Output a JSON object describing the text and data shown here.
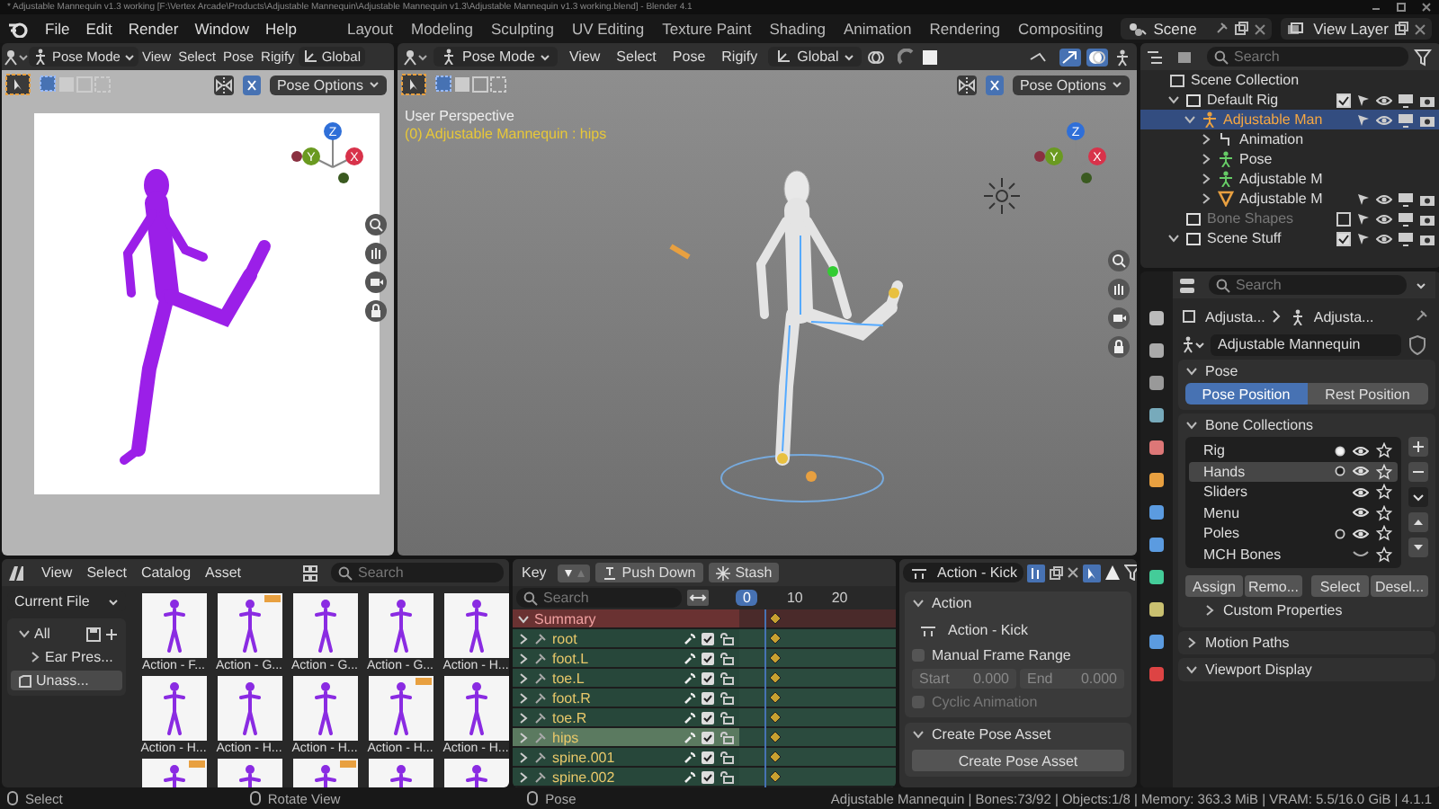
{
  "window": {
    "title": "* Adjustable Mannequin v1.3 working [F:\\Vertex Arcade\\Products\\Adjustable Mannequin\\Adjustable Mannequin v1.3\\Adjustable Mannequin v1.3 working.blend] - Blender 4.1"
  },
  "menu": [
    "File",
    "Edit",
    "Render",
    "Window",
    "Help"
  ],
  "workspaces": [
    {
      "label": "Layout",
      "selected": false
    },
    {
      "label": "Modeling",
      "selected": false
    },
    {
      "label": "Sculpting",
      "selected": false
    },
    {
      "label": "UV Editing",
      "selected": false
    },
    {
      "label": "Texture Paint",
      "selected": false
    },
    {
      "label": "Shading",
      "selected": false
    },
    {
      "label": "Animation",
      "selected": false
    },
    {
      "label": "Rendering",
      "selected": false
    },
    {
      "label": "Compositing",
      "selected": false
    }
  ],
  "scene": "Scene",
  "view_layer": "View Layer",
  "viewports": [
    {
      "kind": "camera",
      "mode": "Pose Mode",
      "menus": [
        "View",
        "Select",
        "Pose",
        "Rigify"
      ],
      "orientation": "Global",
      "options": "Pose Options",
      "axes": [
        "Z",
        "Y",
        "X"
      ]
    },
    {
      "kind": "perspective",
      "mode": "Pose Mode",
      "menus": [
        "View",
        "Select",
        "Pose",
        "Rigify"
      ],
      "orientation": "Global",
      "options": "Pose Options",
      "view_name": "User Perspective",
      "info": "(0) Adjustable Mannequin : hips",
      "axes": [
        "Z",
        "Y",
        "X"
      ]
    }
  ],
  "outliner": {
    "search": {
      "placeholder": "Search"
    },
    "items": [
      {
        "label": "Scene Collection",
        "kind": "scene",
        "selected": false,
        "children": [
          {
            "label": "Default Rig",
            "kind": "collection",
            "expanded": true,
            "selected": false,
            "toggles": true,
            "included": true,
            "children": [
              {
                "label": "Adjustable Man",
                "kind": "armature",
                "expanded": true,
                "selected": true,
                "toggles": true,
                "children": [
                  {
                    "label": "Animation",
                    "kind": "action",
                    "expanded": false,
                    "selected": false
                  },
                  {
                    "label": "Pose",
                    "kind": "pose",
                    "expanded": false,
                    "selected": false
                  },
                  {
                    "label": "Adjustable M",
                    "kind": "bones",
                    "expanded": false,
                    "selected": false
                  },
                  {
                    "label": "Adjustable M",
                    "kind": "mesh",
                    "expanded": false,
                    "selected": false,
                    "toggles": true
                  }
                ]
              }
            ]
          },
          {
            "label": "Bone Shapes",
            "kind": "collection",
            "selected": false,
            "toggles": true,
            "included": false,
            "disabled": true
          },
          {
            "label": "Scene Stuff",
            "kind": "collection",
            "expanded": true,
            "selected": false,
            "toggles": true,
            "included": true
          }
        ]
      }
    ]
  },
  "properties": {
    "search": {
      "placeholder": "Search"
    },
    "breadcrumb": [
      "Adjusta...",
      "Adjusta..."
    ],
    "name": "Adjustable Mannequin",
    "pose_panel": {
      "title": "Pose",
      "expanded": true,
      "options": [
        {
          "label": "Pose Position",
          "selected": true
        },
        {
          "label": "Rest Position",
          "selected": false
        }
      ]
    },
    "bone_collections": {
      "title": "Bone Collections",
      "expanded": true,
      "items": [
        {
          "name": "Rig",
          "selected": false,
          "has_selected_bones": true,
          "has_active_bone": true,
          "visible": true
        },
        {
          "name": "Hands",
          "selected": true,
          "has_selected_bones": true,
          "has_active_bone": false,
          "visible": true
        },
        {
          "name": "Sliders",
          "selected": false,
          "has_selected_bones": false,
          "has_active_bone": false,
          "visible": true
        },
        {
          "name": "Menu",
          "selected": false,
          "has_selected_bones": false,
          "has_active_bone": false,
          "visible": true
        },
        {
          "name": "Poles",
          "selected": false,
          "has_selected_bones": true,
          "has_active_bone": false,
          "visible": true
        },
        {
          "name": "MCH Bones",
          "selected": false,
          "has_selected_bones": false,
          "has_active_bone": false,
          "visible": false
        }
      ],
      "buttons": [
        "Assign",
        "Remo...",
        "Select",
        "Desel..."
      ],
      "subpanels": [
        {
          "title": "Custom Properties",
          "expanded": false
        }
      ]
    },
    "more_panels": [
      {
        "title": "Motion Paths",
        "expanded": false
      },
      {
        "title": "Viewport Display",
        "expanded": true
      }
    ]
  },
  "asset_browser": {
    "menus": [
      "View",
      "Select",
      "Catalog",
      "Asset"
    ],
    "search": {
      "placeholder": "Search"
    },
    "library": "Current File",
    "catalogs": [
      {
        "label": "All",
        "expanded": true,
        "selected": false,
        "children": [
          {
            "label": "Ear Pres...",
            "expanded": false,
            "selected": false
          }
        ]
      },
      {
        "label": "Unass...",
        "selected": true
      }
    ],
    "assets": [
      {
        "label": "Action - F...",
        "badge": false
      },
      {
        "label": "Action - G...",
        "badge": true
      },
      {
        "label": "Action - G...",
        "badge": false
      },
      {
        "label": "Action - G...",
        "badge": false
      },
      {
        "label": "Action - H...",
        "badge": false
      },
      {
        "label": "Action - H...",
        "badge": false
      },
      {
        "label": "Action - H...",
        "badge": false
      },
      {
        "label": "Action - H...",
        "badge": false
      },
      {
        "label": "Action - H...",
        "badge": true
      },
      {
        "label": "Action - H...",
        "badge": false
      },
      {
        "badge": true
      },
      {
        "badge": false
      },
      {
        "badge": true
      },
      {
        "badge": false
      },
      {
        "badge": false
      }
    ]
  },
  "dope_sheet": {
    "mode": "Key",
    "buttons": [
      "Push Down",
      "Stash"
    ],
    "action": "Action - Kick",
    "search": {
      "placeholder": "Search"
    },
    "frames": [
      {
        "label": "0",
        "selected": true
      },
      {
        "label": "10",
        "selected": false
      },
      {
        "label": "20",
        "selected": false
      }
    ],
    "channels": [
      {
        "name": "Summary",
        "kind": "summary",
        "selected": false
      },
      {
        "name": "root",
        "kind": "group",
        "selected": false
      },
      {
        "name": "foot.L",
        "kind": "group",
        "selected": false
      },
      {
        "name": "toe.L",
        "kind": "group",
        "selected": false
      },
      {
        "name": "foot.R",
        "kind": "group",
        "selected": false
      },
      {
        "name": "toe.R",
        "kind": "group",
        "selected": false
      },
      {
        "name": "hips",
        "kind": "group",
        "selected": true
      },
      {
        "name": "spine.001",
        "kind": "group",
        "selected": false
      },
      {
        "name": "spine.002",
        "kind": "group",
        "selected": false
      }
    ]
  },
  "action_panel": {
    "title": "Action",
    "action": "Action - Kick",
    "manual_range": {
      "label": "Manual Frame Range",
      "checked": false
    },
    "start": {
      "label": "Start",
      "value": "0.000",
      "disabled": true
    },
    "end": {
      "label": "End",
      "value": "0.000",
      "disabled": true
    },
    "cyclic": {
      "label": "Cyclic Animation",
      "checked": false,
      "disabled": true
    },
    "pose_asset": {
      "title": "Create Pose Asset",
      "button": "Create Pose Asset"
    }
  },
  "status_bar": {
    "hints": [
      "Select",
      "Rotate View",
      "Pose"
    ],
    "info": "Adjustable Mannequin | Bones:73/92 | Objects:1/8 | Memory: 363.3 MiB | VRAM: 5.5/16.0 GiB | 4.1.1"
  }
}
